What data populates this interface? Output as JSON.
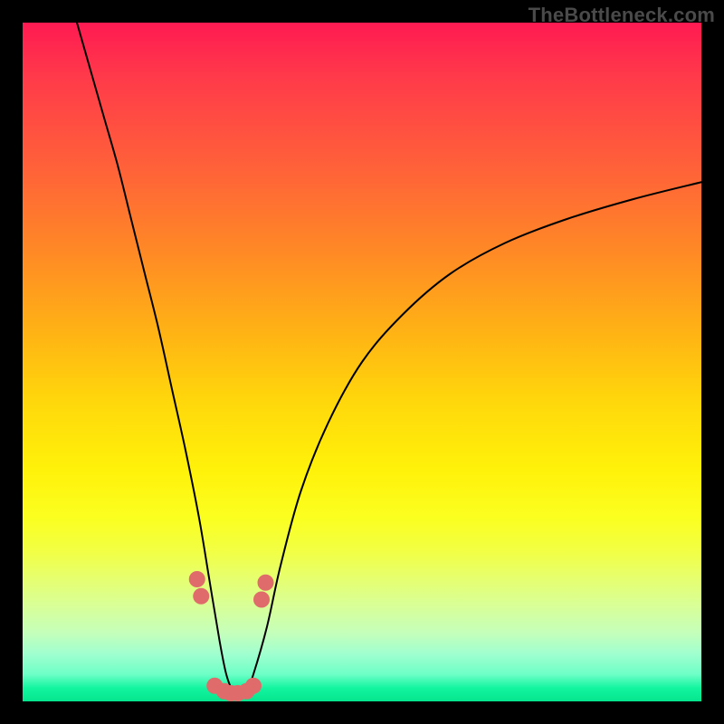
{
  "watermark": "TheBottleneck.com",
  "chart_data": {
    "type": "line",
    "title": "",
    "xlabel": "",
    "ylabel": "",
    "xlim": [
      0,
      100
    ],
    "ylim": [
      0,
      100
    ],
    "grid": false,
    "legend": false,
    "background_gradient": {
      "direction": "vertical",
      "stops": [
        {
          "pos": 0,
          "color": "#ff1a52"
        },
        {
          "pos": 22,
          "color": "#ff6338"
        },
        {
          "pos": 46,
          "color": "#ffb414"
        },
        {
          "pos": 66,
          "color": "#fff20a"
        },
        {
          "pos": 86,
          "color": "#d8ff98"
        },
        {
          "pos": 100,
          "color": "#04e58e"
        }
      ]
    },
    "series": [
      {
        "name": "bottleneck-curve",
        "type": "line",
        "color": "#000000",
        "stroke_width": 2,
        "x": [
          8,
          10,
          12,
          14,
          16,
          18,
          20,
          22,
          24,
          26,
          27.5,
          29,
          30,
          31,
          32,
          33,
          34,
          36,
          38,
          41,
          45,
          50,
          56,
          63,
          71,
          80,
          90,
          100
        ],
        "y": [
          100,
          93,
          86,
          79,
          71,
          63,
          55,
          46,
          37,
          27,
          18,
          9,
          4,
          1.5,
          1,
          1.5,
          4,
          11,
          20,
          31,
          41,
          50,
          57,
          63,
          67.5,
          71,
          74,
          76.5
        ]
      },
      {
        "name": "markers",
        "type": "scatter",
        "color": "#e06b6b",
        "marker_radius": 9,
        "x": [
          25.7,
          26.3,
          28.3,
          29.7,
          30.7,
          31.7,
          33.0,
          34.0,
          35.2,
          35.8
        ],
        "y": [
          18.0,
          15.5,
          2.3,
          1.5,
          1.2,
          1.2,
          1.5,
          2.3,
          15.0,
          17.5
        ]
      }
    ]
  }
}
